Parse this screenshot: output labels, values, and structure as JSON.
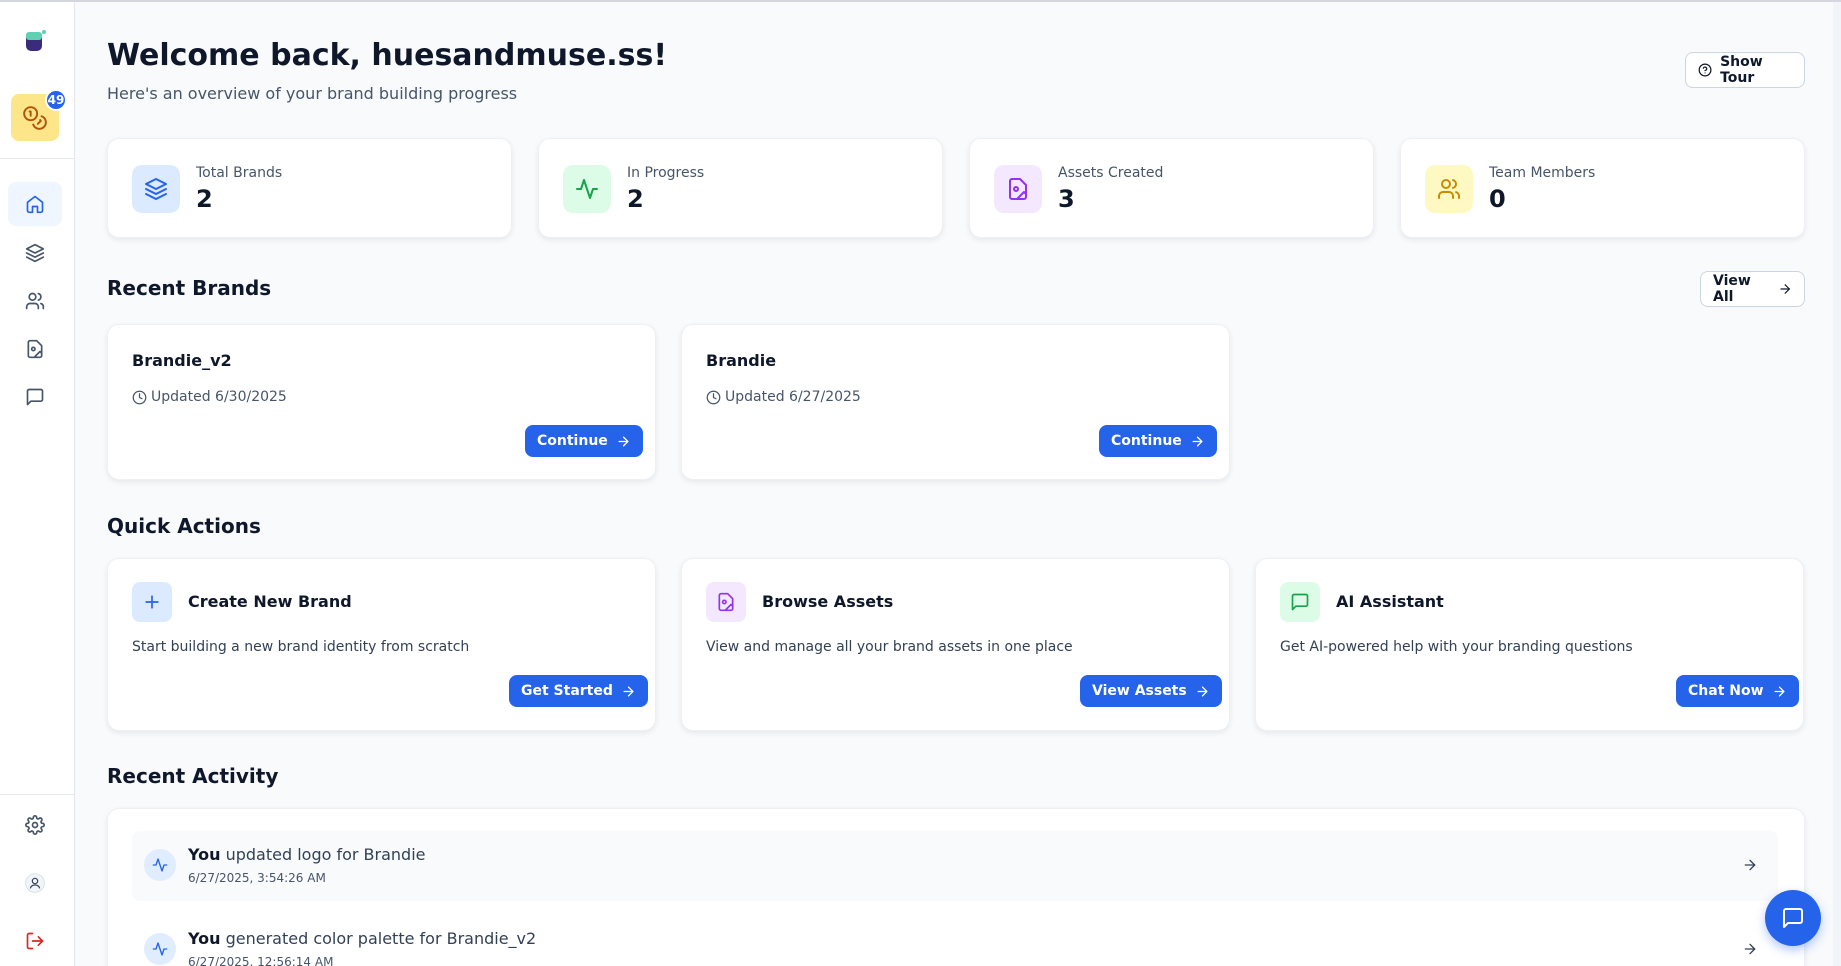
{
  "sidebar": {
    "coins_badge": "49",
    "nav": [
      {
        "name": "home",
        "active": true
      },
      {
        "name": "brands",
        "active": false
      },
      {
        "name": "team",
        "active": false
      },
      {
        "name": "assets",
        "active": false
      },
      {
        "name": "chat",
        "active": false
      }
    ]
  },
  "header": {
    "title": "Welcome back, huesandmuse.ss!",
    "subtitle": "Here's an overview of your brand building progress",
    "show_tour": "Show Tour"
  },
  "stats": [
    {
      "label": "Total Brands",
      "value": "2",
      "icon": "layers-icon",
      "color": "#2563eb",
      "bg": "#dbeafe"
    },
    {
      "label": "In Progress",
      "value": "2",
      "icon": "activity-icon",
      "color": "#16a34a",
      "bg": "#dcfce7"
    },
    {
      "label": "Assets Created",
      "value": "3",
      "icon": "file-image-icon",
      "color": "#9333ea",
      "bg": "#f3e8ff"
    },
    {
      "label": "Team Members",
      "value": "0",
      "icon": "users-icon",
      "color": "#ca8a04",
      "bg": "#fef9c3"
    }
  ],
  "recent_brands": {
    "title": "Recent Brands",
    "view_all": "View All",
    "items": [
      {
        "name": "Brandie_v2",
        "updated": "Updated 6/30/2025",
        "action": "Continue"
      },
      {
        "name": "Brandie",
        "updated": "Updated 6/27/2025",
        "action": "Continue"
      }
    ]
  },
  "quick_actions": {
    "title": "Quick Actions",
    "items": [
      {
        "title": "Create New Brand",
        "desc": "Start building a new brand identity from scratch",
        "action": "Get Started",
        "icon": "plus-icon",
        "color": "#2563eb",
        "bg": "#dbeafe"
      },
      {
        "title": "Browse Assets",
        "desc": "View and manage all your brand assets in one place",
        "action": "View Assets",
        "icon": "file-image-icon",
        "color": "#9333ea",
        "bg": "#f3e8ff"
      },
      {
        "title": "AI Assistant",
        "desc": "Get AI-powered help with your branding questions",
        "action": "Chat Now",
        "icon": "message-square-icon",
        "color": "#16a34a",
        "bg": "#dcfce7"
      }
    ]
  },
  "recent_activity": {
    "title": "Recent Activity",
    "items": [
      {
        "actor": "You",
        "text": " updated logo for Brandie",
        "time": "6/27/2025, 3:54:26 AM"
      },
      {
        "actor": "You",
        "text": " generated color palette for Brandie_v2",
        "time": "6/27/2025, 12:56:14 AM"
      }
    ]
  },
  "colors": {
    "primary": "#2563eb",
    "logout": "#dc2626"
  }
}
